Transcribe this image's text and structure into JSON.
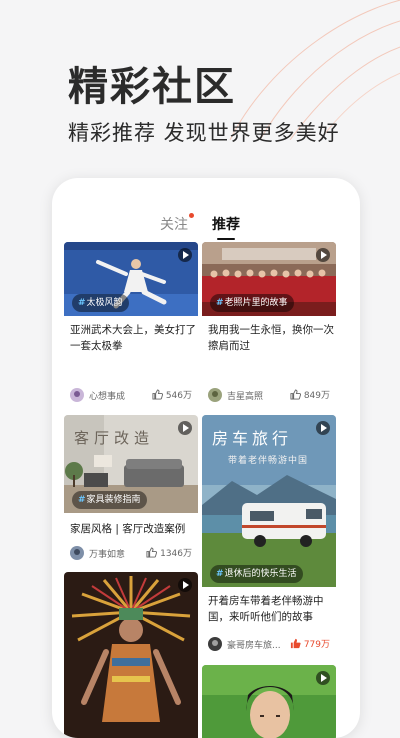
{
  "promo": {
    "headline": "精彩社区",
    "subline": "精彩推荐 发现世界更多美好"
  },
  "colors": {
    "accent": "#e84a2d",
    "background": "#f5f5f6",
    "tag_hash": "#6cc7ff"
  },
  "tabs": {
    "follow": "关注",
    "recommend": "推荐",
    "selected": "推荐"
  },
  "feed": [
    {
      "tag": "太极风韵",
      "title": "亚洲武术大会上，美女打了一套太极拳",
      "author": "心想事成",
      "likes": "546万",
      "has_video": true
    },
    {
      "tag": "老照片里的故事",
      "title": "我用我一生永恒，换你一次擦肩而过",
      "author": "吉星高照",
      "likes": "849万",
      "has_video": true
    },
    {
      "tag": "家具装修指南",
      "image_text": "客厅改造",
      "title": "家居风格 | 客厅改造案例",
      "author": "万事如意",
      "likes": "1346万",
      "has_video": true
    },
    {
      "tag": "退休后的快乐生活",
      "image_text": "房车旅行",
      "image_subtext": "带着老伴畅游中国",
      "title": "开着房车带着老伴畅游中国，来听听他们的故事",
      "author": "豪哥房车旅...",
      "likes": "779万",
      "likes_highlighted": true,
      "has_video": true
    },
    {
      "has_video": true
    },
    {
      "has_video": true
    }
  ]
}
